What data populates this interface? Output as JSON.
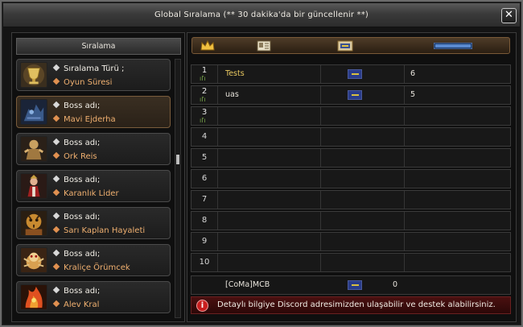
{
  "window": {
    "title": "Global Sıralama (** 30 dakika'da bir güncellenir **)",
    "close_label": "✕"
  },
  "sidebar": {
    "header": "Sıralama",
    "items": [
      {
        "prefix": "Sıralama Türü ;",
        "value": "Oyun Süresi",
        "icon": "trophy-portrait"
      },
      {
        "prefix": "Boss adı;",
        "value": "Mavi Ejderha",
        "icon": "blue-dragon-portrait"
      },
      {
        "prefix": "Boss adı;",
        "value": "Ork Reis",
        "icon": "orc-chief-portrait"
      },
      {
        "prefix": "Boss adı;",
        "value": "Karanlık Lider",
        "icon": "dark-leader-portrait"
      },
      {
        "prefix": "Boss adı;",
        "value": "Sarı Kaplan Hayaleti",
        "icon": "yellow-tiger-portrait"
      },
      {
        "prefix": "Boss adı;",
        "value": "Kraliçe Örümcek",
        "icon": "queen-spider-portrait"
      },
      {
        "prefix": "Boss adı;",
        "value": "Alev Kral",
        "icon": "flame-king-portrait"
      }
    ]
  },
  "table": {
    "header_icons": [
      "crown-icon",
      "name-card-icon",
      "guild-flag-icon",
      "progress-bar-icon"
    ],
    "rows": [
      {
        "rank": "1",
        "name": "Tests",
        "name_color": "#e8c860",
        "has_flag": true,
        "score": "6"
      },
      {
        "rank": "2",
        "name": "uas",
        "name_color": "#e8e4dc",
        "has_flag": true,
        "score": "5"
      },
      {
        "rank": "3",
        "name": "",
        "has_flag": false,
        "score": ""
      },
      {
        "rank": "4",
        "name": "",
        "has_flag": false,
        "score": ""
      },
      {
        "rank": "5",
        "name": "",
        "has_flag": false,
        "score": ""
      },
      {
        "rank": "6",
        "name": "",
        "has_flag": false,
        "score": ""
      },
      {
        "rank": "7",
        "name": "",
        "has_flag": false,
        "score": ""
      },
      {
        "rank": "8",
        "name": "",
        "has_flag": false,
        "score": ""
      },
      {
        "rank": "9",
        "name": "",
        "has_flag": false,
        "score": ""
      },
      {
        "rank": "10",
        "name": "",
        "has_flag": false,
        "score": ""
      }
    ],
    "self_row": {
      "name": "[CoMa]MCB",
      "score": "0"
    }
  },
  "info": {
    "icon": "i",
    "text": "Detaylı bilgiye Discord adresimizden ulaşabilir ve destek alabilirsiniz."
  },
  "colors": {
    "accent": "#7a5a38",
    "info_bg": "#4a1010",
    "rank_name_gold": "#e8c860"
  }
}
